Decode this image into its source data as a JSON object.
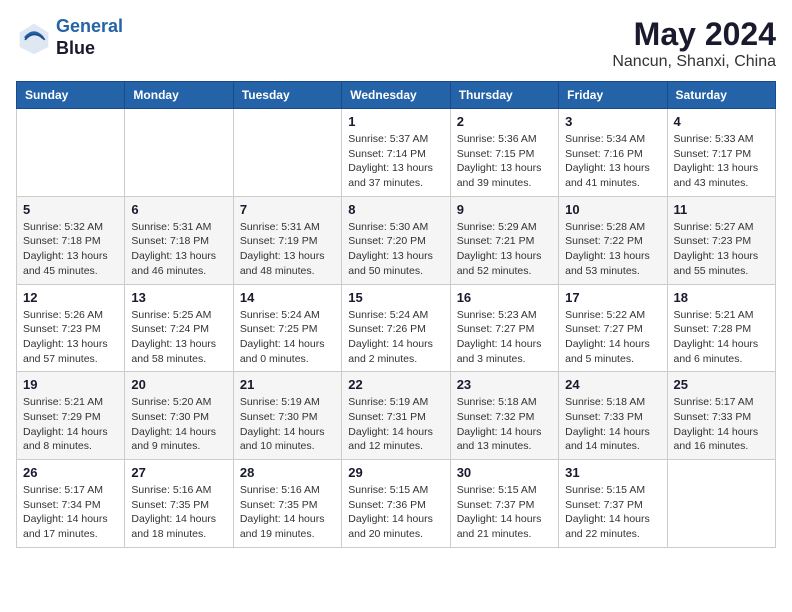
{
  "header": {
    "logo_line1": "General",
    "logo_line2": "Blue",
    "month_year": "May 2024",
    "location": "Nancun, Shanxi, China"
  },
  "weekdays": [
    "Sunday",
    "Monday",
    "Tuesday",
    "Wednesday",
    "Thursday",
    "Friday",
    "Saturday"
  ],
  "weeks": [
    [
      {
        "day": "",
        "info": ""
      },
      {
        "day": "",
        "info": ""
      },
      {
        "day": "",
        "info": ""
      },
      {
        "day": "1",
        "info": "Sunrise: 5:37 AM\nSunset: 7:14 PM\nDaylight: 13 hours\nand 37 minutes."
      },
      {
        "day": "2",
        "info": "Sunrise: 5:36 AM\nSunset: 7:15 PM\nDaylight: 13 hours\nand 39 minutes."
      },
      {
        "day": "3",
        "info": "Sunrise: 5:34 AM\nSunset: 7:16 PM\nDaylight: 13 hours\nand 41 minutes."
      },
      {
        "day": "4",
        "info": "Sunrise: 5:33 AM\nSunset: 7:17 PM\nDaylight: 13 hours\nand 43 minutes."
      }
    ],
    [
      {
        "day": "5",
        "info": "Sunrise: 5:32 AM\nSunset: 7:18 PM\nDaylight: 13 hours\nand 45 minutes."
      },
      {
        "day": "6",
        "info": "Sunrise: 5:31 AM\nSunset: 7:18 PM\nDaylight: 13 hours\nand 46 minutes."
      },
      {
        "day": "7",
        "info": "Sunrise: 5:31 AM\nSunset: 7:19 PM\nDaylight: 13 hours\nand 48 minutes."
      },
      {
        "day": "8",
        "info": "Sunrise: 5:30 AM\nSunset: 7:20 PM\nDaylight: 13 hours\nand 50 minutes."
      },
      {
        "day": "9",
        "info": "Sunrise: 5:29 AM\nSunset: 7:21 PM\nDaylight: 13 hours\nand 52 minutes."
      },
      {
        "day": "10",
        "info": "Sunrise: 5:28 AM\nSunset: 7:22 PM\nDaylight: 13 hours\nand 53 minutes."
      },
      {
        "day": "11",
        "info": "Sunrise: 5:27 AM\nSunset: 7:23 PM\nDaylight: 13 hours\nand 55 minutes."
      }
    ],
    [
      {
        "day": "12",
        "info": "Sunrise: 5:26 AM\nSunset: 7:23 PM\nDaylight: 13 hours\nand 57 minutes."
      },
      {
        "day": "13",
        "info": "Sunrise: 5:25 AM\nSunset: 7:24 PM\nDaylight: 13 hours\nand 58 minutes."
      },
      {
        "day": "14",
        "info": "Sunrise: 5:24 AM\nSunset: 7:25 PM\nDaylight: 14 hours\nand 0 minutes."
      },
      {
        "day": "15",
        "info": "Sunrise: 5:24 AM\nSunset: 7:26 PM\nDaylight: 14 hours\nand 2 minutes."
      },
      {
        "day": "16",
        "info": "Sunrise: 5:23 AM\nSunset: 7:27 PM\nDaylight: 14 hours\nand 3 minutes."
      },
      {
        "day": "17",
        "info": "Sunrise: 5:22 AM\nSunset: 7:27 PM\nDaylight: 14 hours\nand 5 minutes."
      },
      {
        "day": "18",
        "info": "Sunrise: 5:21 AM\nSunset: 7:28 PM\nDaylight: 14 hours\nand 6 minutes."
      }
    ],
    [
      {
        "day": "19",
        "info": "Sunrise: 5:21 AM\nSunset: 7:29 PM\nDaylight: 14 hours\nand 8 minutes."
      },
      {
        "day": "20",
        "info": "Sunrise: 5:20 AM\nSunset: 7:30 PM\nDaylight: 14 hours\nand 9 minutes."
      },
      {
        "day": "21",
        "info": "Sunrise: 5:19 AM\nSunset: 7:30 PM\nDaylight: 14 hours\nand 10 minutes."
      },
      {
        "day": "22",
        "info": "Sunrise: 5:19 AM\nSunset: 7:31 PM\nDaylight: 14 hours\nand 12 minutes."
      },
      {
        "day": "23",
        "info": "Sunrise: 5:18 AM\nSunset: 7:32 PM\nDaylight: 14 hours\nand 13 minutes."
      },
      {
        "day": "24",
        "info": "Sunrise: 5:18 AM\nSunset: 7:33 PM\nDaylight: 14 hours\nand 14 minutes."
      },
      {
        "day": "25",
        "info": "Sunrise: 5:17 AM\nSunset: 7:33 PM\nDaylight: 14 hours\nand 16 minutes."
      }
    ],
    [
      {
        "day": "26",
        "info": "Sunrise: 5:17 AM\nSunset: 7:34 PM\nDaylight: 14 hours\nand 17 minutes."
      },
      {
        "day": "27",
        "info": "Sunrise: 5:16 AM\nSunset: 7:35 PM\nDaylight: 14 hours\nand 18 minutes."
      },
      {
        "day": "28",
        "info": "Sunrise: 5:16 AM\nSunset: 7:35 PM\nDaylight: 14 hours\nand 19 minutes."
      },
      {
        "day": "29",
        "info": "Sunrise: 5:15 AM\nSunset: 7:36 PM\nDaylight: 14 hours\nand 20 minutes."
      },
      {
        "day": "30",
        "info": "Sunrise: 5:15 AM\nSunset: 7:37 PM\nDaylight: 14 hours\nand 21 minutes."
      },
      {
        "day": "31",
        "info": "Sunrise: 5:15 AM\nSunset: 7:37 PM\nDaylight: 14 hours\nand 22 minutes."
      },
      {
        "day": "",
        "info": ""
      }
    ]
  ]
}
